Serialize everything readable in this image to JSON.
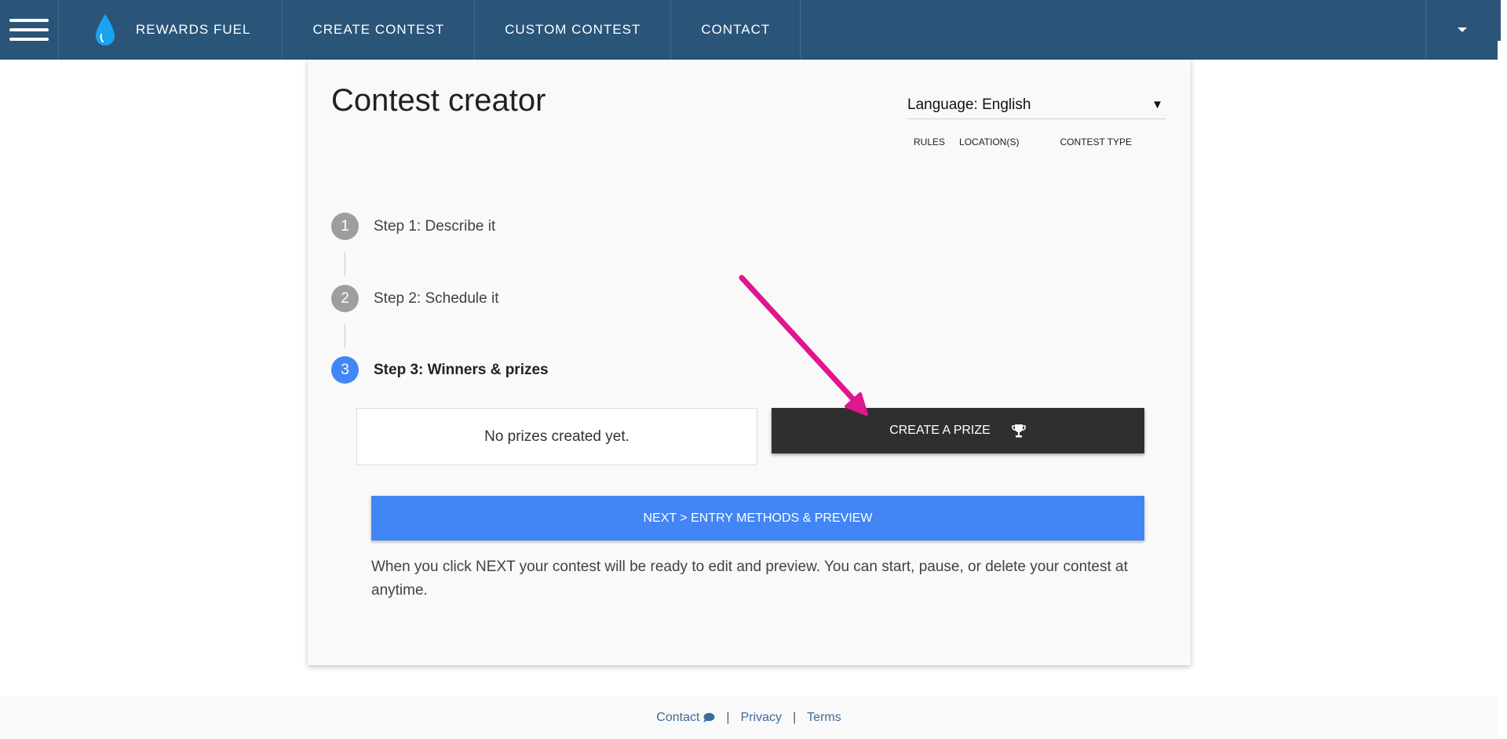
{
  "nav": {
    "brand": "REWARDS FUEL",
    "links": [
      "CREATE CONTEST",
      "CUSTOM CONTEST",
      "CONTACT"
    ]
  },
  "card": {
    "title": "Contest creator",
    "language": "Language: English",
    "language_caret": "▼",
    "sub_tabs": [
      "RULES",
      "LOCATION(S)",
      "CONTEST TYPE"
    ]
  },
  "steps": [
    {
      "number": "1",
      "label": "Step 1: Describe it",
      "active": false
    },
    {
      "number": "2",
      "label": "Step 2: Schedule it",
      "active": false
    },
    {
      "number": "3",
      "label": "Step 3: Winners & prizes",
      "active": true
    }
  ],
  "prizes": {
    "empty_text": "No prizes created yet.",
    "create_label": "CREATE A PRIZE"
  },
  "next_label": "NEXT > ENTRY METHODS & PREVIEW",
  "help_text": "When you click NEXT your contest will be ready to edit and preview. You can start, pause, or delete your contest at anytime.",
  "footer": {
    "contact": "Contact",
    "privacy": "Privacy",
    "terms": "Terms",
    "separator": "|"
  },
  "colors": {
    "nav_bg": "#2b5479",
    "accent_blue": "#4285f4",
    "dark_button": "#2f2f2f",
    "arrow": "#e0168f",
    "drop_icon": "#1aa3f0"
  },
  "icons": [
    "menu-icon",
    "water-drop-icon",
    "caret-down-icon",
    "trophy-icon",
    "chat-bubble-icon"
  ]
}
